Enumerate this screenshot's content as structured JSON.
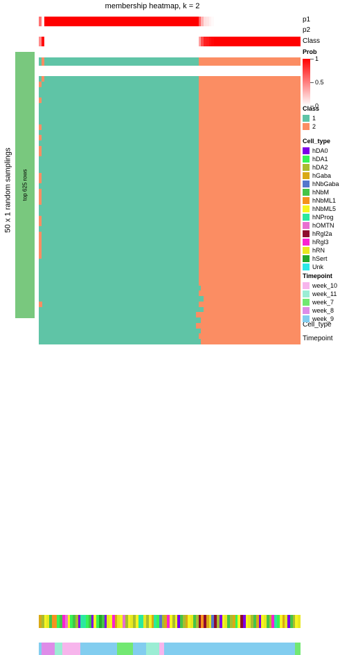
{
  "title": "membership heatmap, k = 2",
  "row_annotation": {
    "outer_label": "50 x 1 random samplings",
    "inner_label": "top 625 rows",
    "color": "#79C87E"
  },
  "top_annotation_labels": {
    "p1": "p1",
    "p2": "p2",
    "class": "Class"
  },
  "bottom_annotation_labels": {
    "cell_type": "Cell_type",
    "timepoint": "Timepoint"
  },
  "legends": {
    "prob": {
      "title": "Prob",
      "ticks": [
        "1",
        "0.5",
        "0"
      ],
      "high_color": "#FF0000",
      "low_color": "#FFFFFF"
    },
    "class": {
      "title": "Class",
      "items": [
        {
          "label": "1",
          "color": "#5FC4A6"
        },
        {
          "label": "2",
          "color": "#FB8D63"
        }
      ]
    },
    "cell_type": {
      "title": "Cell_type",
      "items": [
        {
          "label": "hDA0",
          "color": "#7D00E8"
        },
        {
          "label": "hDA1",
          "color": "#37F456"
        },
        {
          "label": "hDA2",
          "color": "#A8BC30"
        },
        {
          "label": "hGaba",
          "color": "#D9A915"
        },
        {
          "label": "hNbGaba",
          "color": "#5577CC"
        },
        {
          "label": "hNbM",
          "color": "#45C447"
        },
        {
          "label": "hNbML1",
          "color": "#F5921E"
        },
        {
          "label": "hNbML5",
          "color": "#F5F520"
        },
        {
          "label": "hNProg",
          "color": "#2BE8A0"
        },
        {
          "label": "hOMTN",
          "color": "#E86FD0"
        },
        {
          "label": "hRgl2a",
          "color": "#8E0A2E"
        },
        {
          "label": "hRgl3",
          "color": "#FA21D1"
        },
        {
          "label": "hRN",
          "color": "#E8E820"
        },
        {
          "label": "hSert",
          "color": "#23A82B"
        },
        {
          "label": "Unk",
          "color": "#2BE8E8"
        }
      ]
    },
    "timepoint": {
      "title": "Timepoint",
      "items": [
        {
          "label": "week_10",
          "color": "#F7B5EC"
        },
        {
          "label": "week_11",
          "color": "#9BEDD4"
        },
        {
          "label": "week_7",
          "color": "#72E872"
        },
        {
          "label": "week_8",
          "color": "#DE8CE8"
        },
        {
          "label": "week_9",
          "color": "#82CDEF"
        }
      ]
    }
  },
  "chart_data": {
    "type": "heatmap",
    "title": "membership heatmap, k = 2",
    "ylabel": "50 x 1 random samplings",
    "row_block_label": "top 625 rows",
    "n_columns": 100,
    "n_rows": 50,
    "class_split_column": 61,
    "cell_colors": {
      "class1": "#5FC4A6",
      "class2": "#FB8D63"
    },
    "column_classes": [
      1,
      2,
      1,
      1,
      1,
      1,
      1,
      1,
      1,
      1,
      1,
      1,
      1,
      1,
      1,
      1,
      1,
      1,
      1,
      1,
      1,
      1,
      1,
      1,
      1,
      1,
      1,
      1,
      1,
      1,
      1,
      1,
      1,
      1,
      1,
      1,
      1,
      1,
      1,
      1,
      1,
      1,
      1,
      1,
      1,
      1,
      1,
      1,
      1,
      1,
      1,
      1,
      1,
      1,
      1,
      1,
      1,
      1,
      1,
      1,
      1,
      2,
      2,
      2,
      2,
      2,
      2,
      2,
      2,
      2,
      2,
      2,
      2,
      2,
      2,
      2,
      2,
      2,
      2,
      2,
      2,
      2,
      2,
      2,
      2,
      2,
      2,
      2,
      2,
      2,
      2,
      2,
      2,
      2,
      2,
      2,
      2,
      2,
      2,
      2
    ],
    "p1_values": [
      0.55,
      0.05,
      1,
      1,
      1,
      1,
      1,
      1,
      1,
      1,
      1,
      1,
      1,
      1,
      1,
      1,
      1,
      1,
      1,
      1,
      1,
      1,
      1,
      1,
      1,
      1,
      1,
      1,
      1,
      1,
      1,
      1,
      1,
      1,
      1,
      1,
      1,
      1,
      1,
      1,
      1,
      1,
      1,
      1,
      1,
      1,
      1,
      1,
      1,
      1,
      1,
      1,
      1,
      1,
      1,
      1,
      1,
      1,
      1,
      1,
      1,
      0.62,
      0.3,
      0.12,
      0.1,
      0.05,
      0.02,
      0,
      0,
      0,
      0,
      0,
      0,
      0,
      0,
      0,
      0,
      0,
      0,
      0,
      0,
      0,
      0,
      0,
      0,
      0,
      0,
      0,
      0,
      0,
      0,
      0,
      0,
      0,
      0,
      0,
      0,
      0,
      0,
      0
    ],
    "p2_values": [
      0.45,
      0.95,
      0,
      0,
      0,
      0,
      0,
      0,
      0,
      0,
      0,
      0,
      0,
      0,
      0,
      0,
      0,
      0,
      0,
      0,
      0,
      0,
      0,
      0,
      0,
      0,
      0,
      0,
      0,
      0,
      0,
      0,
      0,
      0,
      0,
      0,
      0,
      0,
      0,
      0,
      0,
      0,
      0,
      0,
      0,
      0,
      0,
      0,
      0,
      0,
      0,
      0,
      0,
      0,
      0,
      0,
      0,
      0,
      0,
      0,
      0,
      0.38,
      0.7,
      0.88,
      0.9,
      0.95,
      0.98,
      1,
      1,
      1,
      1,
      1,
      1,
      1,
      1,
      1,
      1,
      1,
      1,
      1,
      1,
      1,
      1,
      1,
      1,
      1,
      1,
      1,
      1,
      1,
      1,
      1,
      1,
      1,
      1,
      1,
      1,
      1,
      1,
      1
    ],
    "cell_type_track": [
      "hGaba",
      "hDA2",
      "hNbML5",
      "hRN",
      "hNbM",
      "hNbML1",
      "hNbML1",
      "hDA1",
      "hNbM",
      "hRgl3",
      "hOMTN",
      "hNbML5",
      "hDA1",
      "hNbM",
      "hDA2",
      "hDA0",
      "hNProg",
      "hNProg",
      "hDA1",
      "hNbM",
      "hDA0",
      "hNbML5",
      "hDA1",
      "hSert",
      "hNbM",
      "hDA0",
      "hRN",
      "hNbML5",
      "hRgl3",
      "hGaba",
      "hRN",
      "hNbML5",
      "hOMTN",
      "hDA2",
      "hNbML5",
      "hRN",
      "hDA2",
      "hNbML5",
      "hNProg",
      "hNProg",
      "hRN",
      "hDA2",
      "hNbML5",
      "hGaba",
      "hNProg",
      "hDA1",
      "hNbGaba",
      "hDA2",
      "hGaba",
      "hRgl3",
      "hNbML5",
      "hDA2",
      "hNbML5",
      "hDA0",
      "hNbM",
      "hDA2",
      "hGaba",
      "hNbML5",
      "hRN",
      "hNbM",
      "hDA2",
      "hRgl2a",
      "hNbML1",
      "hRgl2a",
      "hGaba",
      "hRN",
      "hNbGaba",
      "hRgl2a",
      "hDA2",
      "hDA0",
      "hNbML5",
      "hRN",
      "hNbM",
      "hDA2",
      "hGaba",
      "hDA1",
      "hNbML5",
      "hRgl2a",
      "hDA0",
      "hNbML5",
      "hRN",
      "hDA2",
      "hNbM",
      "hGaba",
      "hDA0",
      "hNbML5",
      "hRN",
      "hNbM",
      "hDA2",
      "hRgl3",
      "hNProg",
      "hDA1",
      "hNbML5",
      "hGaba",
      "hRN",
      "hDA0",
      "hNbM",
      "hDA2",
      "hNbML5",
      "hRN"
    ],
    "timepoint_track": [
      "week_9",
      "week_8",
      "week_8",
      "week_8",
      "week_8",
      "week_8",
      "week_11",
      "week_11",
      "week_11",
      "week_10",
      "week_10",
      "week_10",
      "week_10",
      "week_10",
      "week_10",
      "week_10",
      "week_9",
      "week_9",
      "week_9",
      "week_9",
      "week_9",
      "week_9",
      "week_9",
      "week_9",
      "week_9",
      "week_9",
      "week_9",
      "week_9",
      "week_9",
      "week_9",
      "week_7",
      "week_7",
      "week_7",
      "week_7",
      "week_7",
      "week_7",
      "week_9",
      "week_9",
      "week_9",
      "week_9",
      "week_9",
      "week_11",
      "week_11",
      "week_11",
      "week_11",
      "week_11",
      "week_10",
      "week_10",
      "week_9",
      "week_9",
      "week_9",
      "week_9",
      "week_9",
      "week_9",
      "week_9",
      "week_9",
      "week_9",
      "week_9",
      "week_9",
      "week_9",
      "week_9",
      "week_9",
      "week_9",
      "week_9",
      "week_9",
      "week_9",
      "week_9",
      "week_9",
      "week_9",
      "week_9",
      "week_9",
      "week_9",
      "week_9",
      "week_9",
      "week_9",
      "week_9",
      "week_9",
      "week_9",
      "week_9",
      "week_9",
      "week_9",
      "week_9",
      "week_9",
      "week_9",
      "week_9",
      "week_9",
      "week_9",
      "week_9",
      "week_9",
      "week_9",
      "week_9",
      "week_9",
      "week_9",
      "week_9",
      "week_9",
      "week_9",
      "week_9",
      "week_9",
      "week_7",
      "week_7"
    ]
  }
}
